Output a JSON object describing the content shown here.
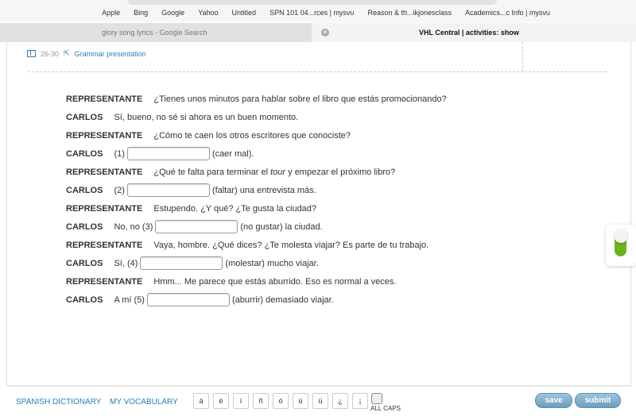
{
  "bookmarks": [
    "Apple",
    "Bing",
    "Google",
    "Yahoo",
    "Untitled",
    "SPN 101 04...rces | mysvu",
    "Reason & th...ikjonesclass",
    "Academics...c Info | mysvu"
  ],
  "tabs": {
    "inactive": "glory song lyrics - Google Search",
    "active": "VHL Central | activities: show"
  },
  "reference": {
    "pages": "26-30",
    "link": "Grammar presentation"
  },
  "dialog": [
    {
      "speaker": "REPRESENTANTE",
      "before": "¿Tienes unos minutos para hablar sobre el libro que estás promocionando?"
    },
    {
      "speaker": "CARLOS",
      "before": "Sí, bueno, no sé si ahora es un buen momento."
    },
    {
      "speaker": "REPRESENTANTE",
      "before": "¿Cómo te caen los otros escritores que conociste?"
    },
    {
      "speaker": "CARLOS",
      "before": "(1)",
      "after": "(caer mal).",
      "value": ""
    },
    {
      "speaker": "REPRESENTANTE",
      "before": "¿Qué te falta para terminar el ",
      "italic": "tour",
      "rest": " y empezar el próximo libro?"
    },
    {
      "speaker": "CARLOS",
      "before": "(2)",
      "after": "(faltar) una entrevista más.",
      "value": ""
    },
    {
      "speaker": "REPRESENTANTE",
      "before": "Estupendo. ¿Y qué? ¿Te gusta la ciudad?"
    },
    {
      "speaker": "CARLOS",
      "before": "No, no (3)",
      "after": "(no gustar) la ciudad.",
      "value": ""
    },
    {
      "speaker": "REPRESENTANTE",
      "before": "Vaya, hombre. ¿Qué dices? ¿Te molesta viajar? Es parte de tu trabajo."
    },
    {
      "speaker": "CARLOS",
      "before": "Sí, (4)",
      "after": "(molestar) mucho viajar.",
      "value": ""
    },
    {
      "speaker": "REPRESENTANTE",
      "before": "Hmm... Me parece que estás aburrido. Eso es normal a veces."
    },
    {
      "speaker": "CARLOS",
      "before": "A mí (5)",
      "after": "(aburrir) demasiado viajar.",
      "value": ""
    }
  ],
  "footer": {
    "dictionary": "SPANISH DICTIONARY",
    "vocabulary": "MY VOCABULARY",
    "keys": [
      "á",
      "é",
      "í",
      "ñ",
      "ó",
      "ú",
      "ü",
      "¿",
      "¡"
    ],
    "all_caps": "ALL CAPS",
    "save": "save",
    "submit": "submit"
  },
  "toggle": {
    "state": "on",
    "color": "#6ab41e"
  }
}
